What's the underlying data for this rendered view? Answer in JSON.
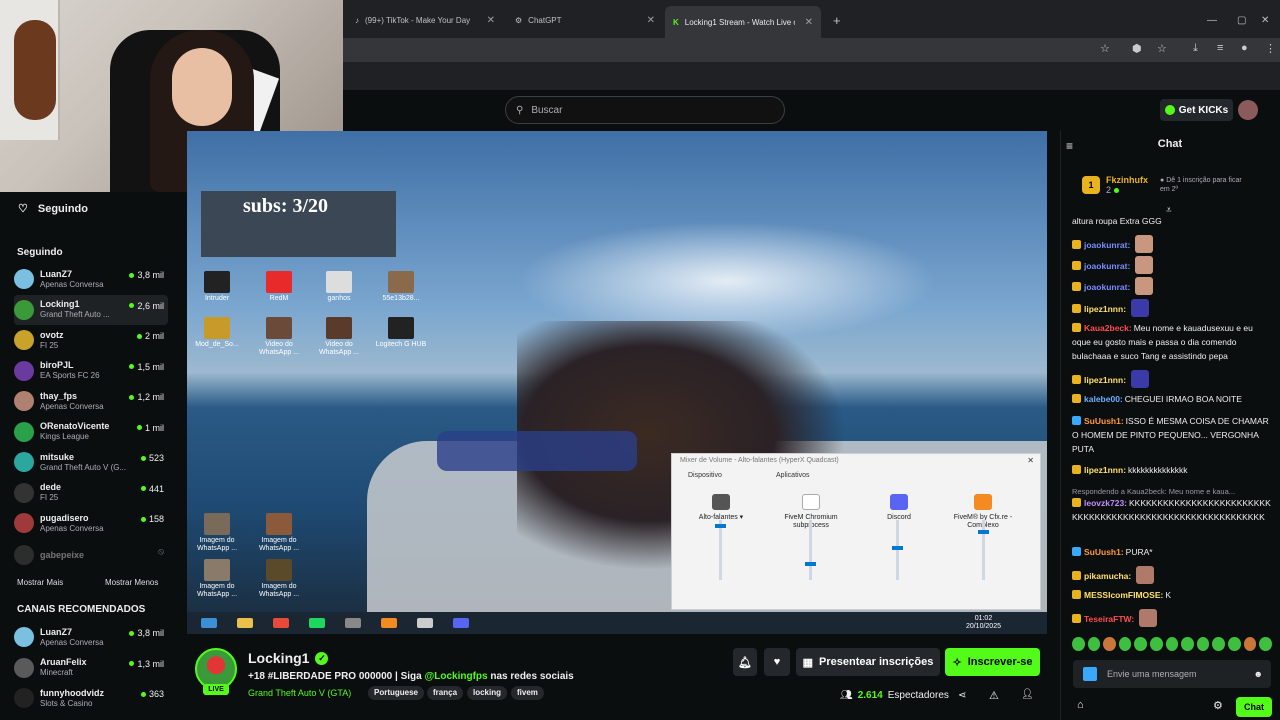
{
  "tabs": [
    {
      "label": "(99+) TikTok - Make Your Day"
    },
    {
      "label": "ChatGPT"
    },
    {
      "label": "Locking1 Stream - Watch Live o"
    }
  ],
  "search": {
    "placeholder": "Buscar"
  },
  "header": {
    "get_kicks": "Get KICKs"
  },
  "overlay": {
    "subs": "subs: 3/20"
  },
  "sidebar": {
    "title": "Seguindo",
    "section_following": "Seguindo",
    "following": [
      {
        "name": "LuanZ7",
        "category": "Apenas Conversa",
        "viewers": "3,8 mil",
        "color": "#7ac0e0"
      },
      {
        "name": "Locking1",
        "category": "Grand Theft Auto ...",
        "viewers": "2,6 mil",
        "color": "#3a9a3a"
      },
      {
        "name": "ovotz",
        "category": "FI 25",
        "viewers": "2 mil",
        "color": "#c8a22a"
      },
      {
        "name": "biroPJL",
        "category": "EA Sports FC 26",
        "viewers": "1,5 mil",
        "color": "#6a3aa0"
      },
      {
        "name": "thay_fps",
        "category": "Apenas Conversa",
        "viewers": "1,2 mil",
        "color": "#b08070"
      },
      {
        "name": "ORenatoVicente",
        "category": "Kings League",
        "viewers": "1 mil",
        "color": "#2aa04a"
      },
      {
        "name": "mitsuke",
        "category": "Grand Theft Auto V (G...",
        "viewers": "523",
        "color": "#2aa8a0"
      },
      {
        "name": "dede",
        "category": "FI 25",
        "viewers": "441",
        "color": "#333333"
      },
      {
        "name": "pugadisero",
        "category": "Apenas Conversa",
        "viewers": "158",
        "color": "#a03a3a"
      }
    ],
    "offline": "gabepeixe",
    "show_more": "Mostrar Mais",
    "show_less": "Mostrar Menos",
    "section_recommended": "CANAIS RECOMENDADOS",
    "recommended": [
      {
        "name": "LuanZ7",
        "category": "Apenas Conversa",
        "viewers": "3,8 mil",
        "color": "#7ac0e0"
      },
      {
        "name": "AruanFelix",
        "category": "Minecraft",
        "viewers": "1,3 mil",
        "color": "#5a5a5a"
      },
      {
        "name": "funnyhoodvidz",
        "category": "Slots & Casino",
        "viewers": "363",
        "color": "#222222"
      }
    ]
  },
  "desktop_icons": [
    {
      "label": "Intruder"
    },
    {
      "label": "RedM"
    },
    {
      "label": "ganhos"
    },
    {
      "label": "55e13b28..."
    },
    {
      "label": "Mod_de_So..."
    },
    {
      "label": "Video do WhatsApp ..."
    },
    {
      "label": "Video do WhatsApp ..."
    },
    {
      "label": "Logitech G HUB"
    },
    {
      "label": "Imagem do WhatsApp ..."
    },
    {
      "label": "Imagem do WhatsApp ..."
    },
    {
      "label": "Imagem do WhatsApp ..."
    },
    {
      "label": "Imagem do WhatsApp ..."
    }
  ],
  "mixer": {
    "title": "Mixer de Volume - Alto-falantes (HyperX Quadcast)",
    "device_label": "Dispositivo",
    "apps_label": "Aplicativos",
    "device": "Alto-falantes",
    "apps": [
      "FiveM Chromium subprocess",
      "Discord",
      "FiveM® by Cfx.re - Complexo"
    ]
  },
  "clock": {
    "time": "01:02",
    "date": "20/10/2025"
  },
  "stream": {
    "channel": "Locking1",
    "live_badge": "LIVE",
    "title_prefix": "+18 #LIBERDADE PRO 000000 | Siga ",
    "title_handle": "@Lockingfps",
    "title_suffix": " nas redes sociais",
    "category": "Grand Theft Auto V (GTA)",
    "tags": [
      "Portuguese",
      "frança",
      "locking",
      "fivem"
    ],
    "gift_button": "Presentear inscrições",
    "subscribe_button": "Inscrever-se",
    "viewers_count": "2.614",
    "viewers_label": "Espectadores"
  },
  "chat": {
    "title": "Chat",
    "pinned_user": "Fkzinhufx",
    "pinned_rank": "1",
    "pinned_count": "2",
    "pinned_cta": "Dê 1 inscrição para ficar em 2º",
    "messages": [
      {
        "user": "",
        "text": "altura roupa Extra GGG",
        "color": "#efeff1"
      },
      {
        "user": "joaokunrat:",
        "text": "",
        "color": "#7a8cff"
      },
      {
        "user": "joaokunrat:",
        "text": "",
        "color": "#7a8cff"
      },
      {
        "user": "joaokunrat:",
        "text": "",
        "color": "#7a8cff"
      },
      {
        "user": "lipez1nnn:",
        "text": "",
        "color": "#ffe066"
      },
      {
        "user": "Kaua2beck:",
        "text": "Meu nome e kauadusexuu e eu oque eu gosto mais e passa o dia comendo bulachaaa e suco Tang e assistindo pepa",
        "color": "#ff4d4d"
      },
      {
        "user": "lipez1nnn:",
        "text": "",
        "color": "#ffe066"
      },
      {
        "user": "kalebe00:",
        "text": "CHEGUEI IRMAO BOA NOITE",
        "color": "#6ab0ff"
      },
      {
        "user": "SuUush1:",
        "text": "ISSO É MESMA COISA DE CHAMAR O HOMEM DE PINTO PEQUENO... VERGONHA PUTA",
        "color": "#ff9a3a"
      },
      {
        "user": "lipez1nnn:",
        "text": "kkkkkkkkkkkkkk",
        "color": "#ffe066"
      },
      {
        "user": "",
        "text": "Respondendo a Kaua2beck: Meu nome e kaua...",
        "color": "#9a9aa2"
      },
      {
        "user": "leovzk723:",
        "text": "KKKKKKKKKKKKKKKKKKKKKKKKKKKKKKKKKKKKKKKKKKKKKKKKKKKKKKKKKKK",
        "color": "#c48cff"
      },
      {
        "user": "SuUush1:",
        "text": "PURA*",
        "color": "#ff9a3a"
      },
      {
        "user": "pikamucha:",
        "text": "",
        "color": "#ffe066"
      },
      {
        "user": "MESSIcomFIMOSE:",
        "text": "K",
        "color": "#ffe066"
      },
      {
        "user": "TeseiraFTW:",
        "text": "",
        "color": "#ff4d4d"
      }
    ],
    "input_placeholder": "Envie uma mensagem",
    "send_button": "Chat"
  },
  "colors": {
    "accent": "#53fc18",
    "background": "#0b0e0f"
  }
}
